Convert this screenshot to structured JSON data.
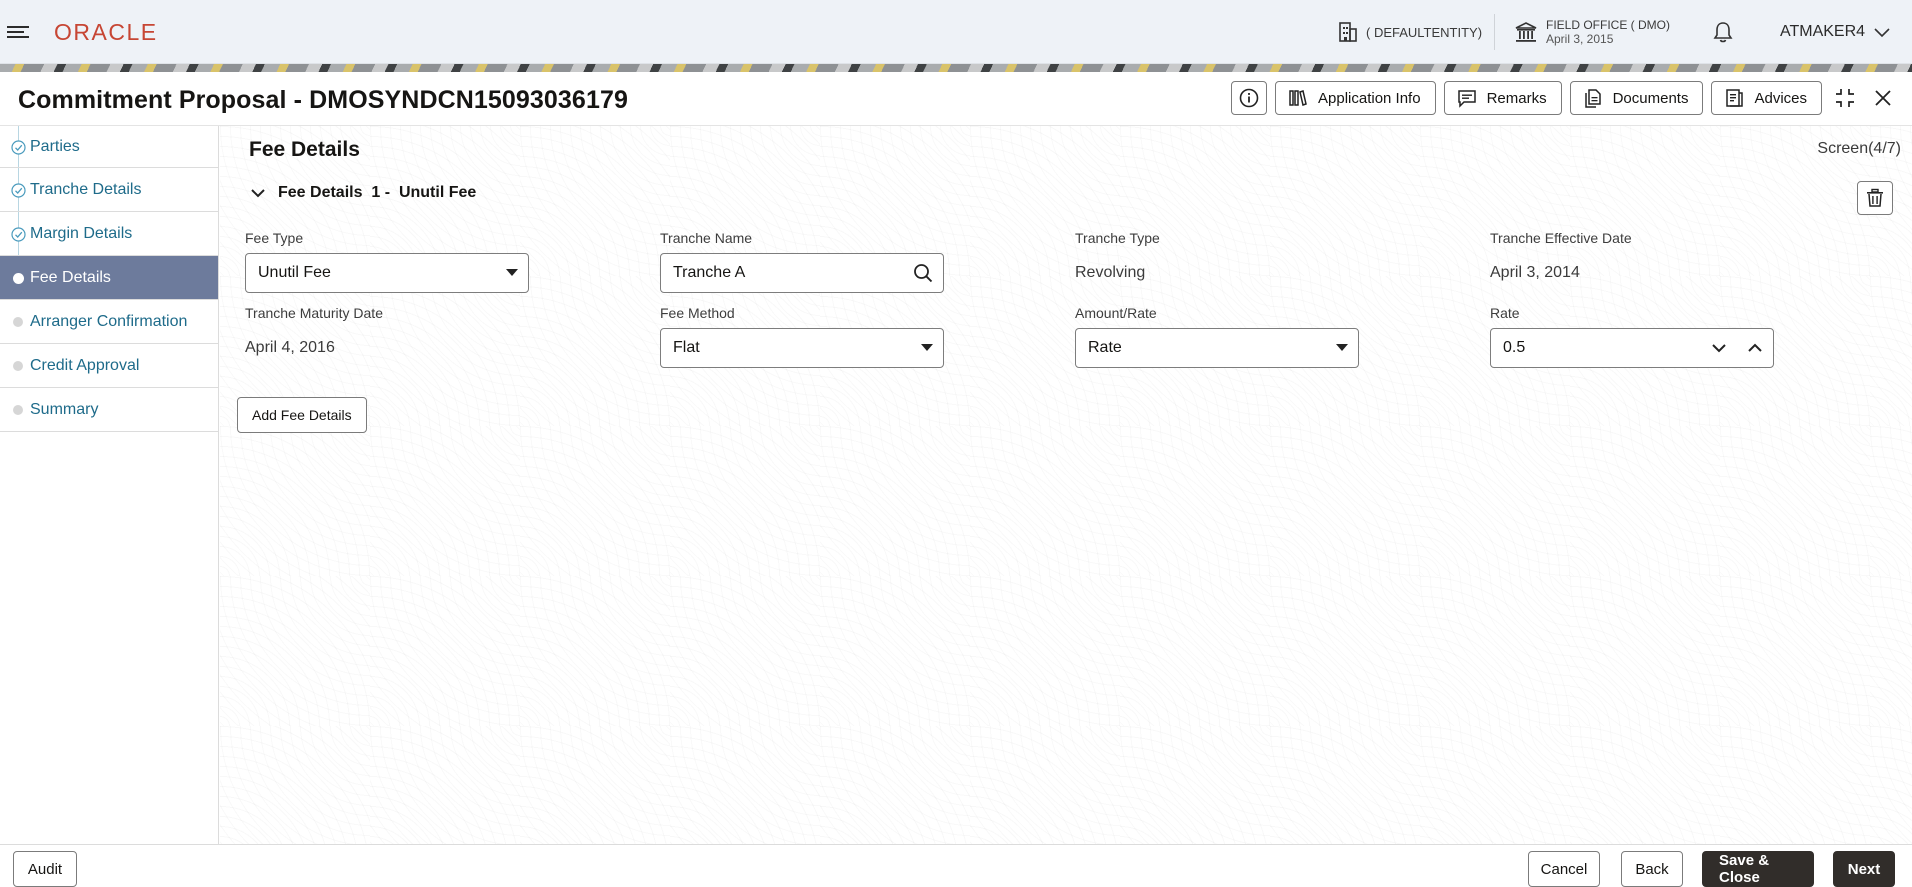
{
  "header": {
    "brand": "ORACLE",
    "entity": "( DEFAULTENTITY)",
    "office_name": "FIELD OFFICE ( DMO)",
    "office_date": "April 3, 2015",
    "user": "ATMAKER4",
    "icons": [
      "hamburger-icon",
      "building-icon",
      "bank-icon",
      "bell-icon",
      "chevron-down-icon"
    ]
  },
  "titlebar": {
    "title": "Commitment Proposal - DMOSYNDCN15093036179",
    "buttons": {
      "application_info": "Application Info",
      "remarks": "Remarks",
      "documents": "Documents",
      "advices": "Advices"
    }
  },
  "sidebar": {
    "steps": [
      {
        "label": "Parties",
        "state": "done"
      },
      {
        "label": "Tranche Details",
        "state": "done"
      },
      {
        "label": "Margin Details",
        "state": "done"
      },
      {
        "label": "Fee Details",
        "state": "active"
      },
      {
        "label": "Arranger Confirmation",
        "state": "pending"
      },
      {
        "label": "Credit Approval",
        "state": "pending"
      },
      {
        "label": "Summary",
        "state": "pending"
      }
    ]
  },
  "main": {
    "section_title": "Fee Details",
    "screen_counter": "Screen(4/7)",
    "accordion_title": "Fee Details  1 -  Unutil Fee",
    "fields": {
      "fee_type": {
        "label": "Fee Type",
        "value": "Unutil Fee"
      },
      "tranche_name": {
        "label": "Tranche Name",
        "value": "Tranche A"
      },
      "tranche_type": {
        "label": "Tranche Type",
        "value": "Revolving"
      },
      "tranche_effective_date": {
        "label": "Tranche Effective Date",
        "value": "April 3, 2014"
      },
      "tranche_maturity_date": {
        "label": "Tranche Maturity Date",
        "value": "April 4, 2016"
      },
      "fee_method": {
        "label": "Fee Method",
        "value": "Flat"
      },
      "amount_rate": {
        "label": "Amount/Rate",
        "value": "Rate"
      },
      "rate": {
        "label": "Rate",
        "value": "0.5"
      }
    },
    "add_button": "Add Fee Details"
  },
  "footer": {
    "audit": "Audit",
    "cancel": "Cancel",
    "back": "Back",
    "save_close": "Save & Close",
    "next": "Next"
  },
  "colors": {
    "header_bg": "#eef2f7",
    "brand_red": "#c74634",
    "link_teal": "#1e6b8a",
    "active_step_bg": "#6d7b9c",
    "primary_dark": "#312d2a"
  }
}
